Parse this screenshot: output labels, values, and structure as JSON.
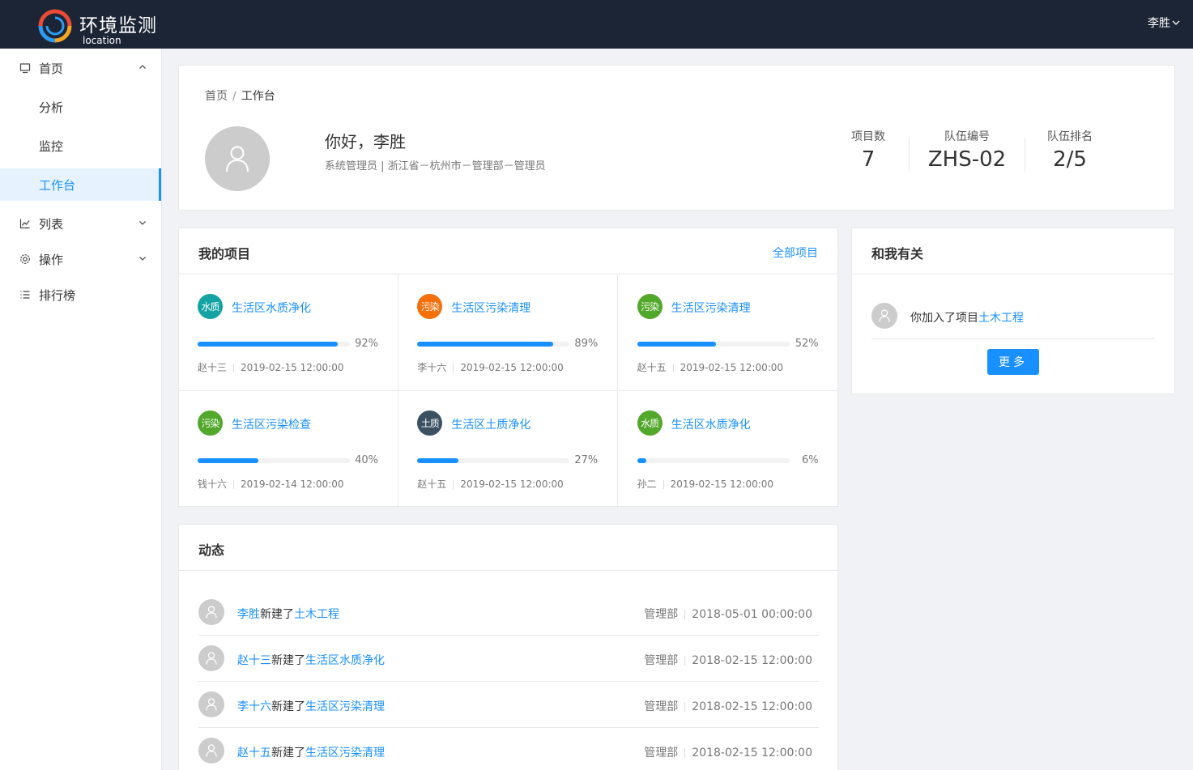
{
  "brand": {
    "title": "环境监测",
    "subtitle": "location"
  },
  "user": {
    "name": "李胜"
  },
  "sidebar": {
    "items": [
      {
        "label": "首页",
        "icon": "monitor-icon",
        "expanded": true
      },
      {
        "label": "分析"
      },
      {
        "label": "监控"
      },
      {
        "label": "工作台",
        "active": true
      },
      {
        "label": "列表",
        "icon": "line-chart-icon",
        "expanded": false
      },
      {
        "label": "操作",
        "icon": "gear-icon",
        "expanded": false
      },
      {
        "label": "排行榜",
        "icon": "list-icon"
      }
    ]
  },
  "breadcrumb": {
    "home": "首页",
    "sep": "/",
    "current": "工作台"
  },
  "profile": {
    "greeting": "你好，李胜",
    "role": "系统管理员 | 浙江省－杭州市－管理部－管理员"
  },
  "stats": [
    {
      "label": "项目数",
      "value": "7"
    },
    {
      "label": "队伍编号",
      "value": "ZHS-02"
    },
    {
      "label": "队伍排名",
      "value": "2/5"
    }
  ],
  "projects_card": {
    "title": "我的项目",
    "link": "全部项目"
  },
  "projects": [
    {
      "badge": "水质",
      "badge_color": "#13a3a3",
      "name": "生活区水质净化",
      "percent": 92,
      "percent_label": "92%",
      "owner": "赵十三",
      "time": "2019-02-15 12:00:00"
    },
    {
      "badge": "污染",
      "badge_color": "#f5700a",
      "name": "生活区污染清理",
      "percent": 89,
      "percent_label": "89%",
      "owner": "李十六",
      "time": "2019-02-15 12:00:00"
    },
    {
      "badge": "污染",
      "badge_color": "#52a82b",
      "name": "生活区污染清理",
      "percent": 52,
      "percent_label": "52%",
      "owner": "赵十五",
      "time": "2019-02-15 12:00:00"
    },
    {
      "badge": "污染",
      "badge_color": "#52a82b",
      "name": "生活区污染检查",
      "percent": 40,
      "percent_label": "40%",
      "owner": "钱十六",
      "time": "2019-02-14 12:00:00"
    },
    {
      "badge": "土质",
      "badge_color": "#3a5162",
      "name": "生活区土质净化",
      "percent": 27,
      "percent_label": "27%",
      "owner": "赵十五",
      "time": "2019-02-15 12:00:00"
    },
    {
      "badge": "水质",
      "badge_color": "#52a82b",
      "name": "生活区水质净化",
      "percent": 6,
      "percent_label": "6%",
      "owner": "孙二",
      "time": "2019-02-15 12:00:00"
    }
  ],
  "related_card": {
    "title": "和我有关",
    "item_prefix": "你加入了项目",
    "item_link": "土木工程",
    "more_button": "更多"
  },
  "activity_card": {
    "title": "动态"
  },
  "activities": [
    {
      "user": "李胜",
      "action": "新建了",
      "project": "土木工程",
      "dept": "管理部",
      "time": "2018-05-01 00:00:00"
    },
    {
      "user": "赵十三",
      "action": "新建了",
      "project": "生活区水质净化",
      "dept": "管理部",
      "time": "2018-02-15 12:00:00"
    },
    {
      "user": "李十六",
      "action": "新建了",
      "project": "生活区污染清理",
      "dept": "管理部",
      "time": "2018-02-15 12:00:00"
    },
    {
      "user": "赵十五",
      "action": "新建了",
      "project": "生活区污染清理",
      "dept": "管理部",
      "time": "2018-02-15 12:00:00"
    }
  ]
}
